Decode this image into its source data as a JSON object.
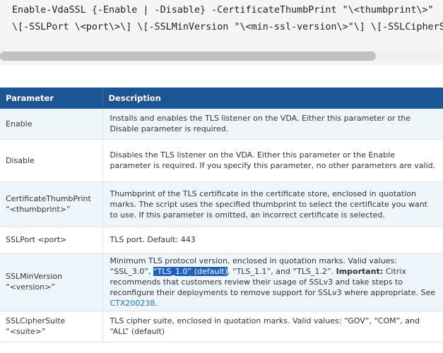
{
  "code": {
    "line1": "Enable-VdaSSL {-Enable | -Disable} -CertificateThumbPrint \"\\<thumbprint\\>\"",
    "line2": "\\[-SSLPort \\<port\\>\\] \\[-SSLMinVersion \"\\<min-ssl-version\\>\"\\] \\[-SSLCipherSuite\""
  },
  "table": {
    "headers": {
      "parameter": "Parameter",
      "description": "Description"
    },
    "rows": [
      {
        "param_line1": "Enable",
        "param_line2": "",
        "desc": "Installs and enables the TLS listener on the VDA. Either this parameter or the Disable parameter is required."
      },
      {
        "param_line1": "Disable",
        "param_line2": "",
        "desc": "Disables the TLS listener on the VDA. Either this parameter or the Enable parameter is required. If you specify this parameter, no other parameters are valid."
      },
      {
        "param_line1": "CertificateThumbPrint",
        "param_line2": "“<thumbprint>”",
        "desc": "Thumbprint of the TLS certificate in the certificate store, enclosed in quotation marks. The script uses the specified thumbprint to select the certificate you want to use. If this parameter is omitted, an incorrect certificate is selected."
      },
      {
        "param_line1": "SSLPort <port>",
        "param_line2": "",
        "desc": "TLS port. Default: 443"
      },
      {
        "param_line1": "SSLMinVersion",
        "param_line2": "“<version>”",
        "desc_parts": {
          "p1": "Minimum TLS protocol version, enclosed in quotation marks. Valid values: “SSL_3.0”, ",
          "highlight": "“TLS_1.0” (default)",
          "p2": ", “TLS_1.1”, and “TLS_1.2”. ",
          "important": "Important:",
          "p3": " Citrix recommends that customers review their usage of SSLv3 and take steps to reconfigure their deployments to remove support for SSLv3 where appropriate. See ",
          "link": "CTX200238",
          "p4": "."
        }
      },
      {
        "param_line1": "SSLCipherSuite",
        "param_line2": "“<suite>”",
        "desc": "TLS cipher suite, enclosed in quotation marks. Valid values: “GOV”, “COM”, and “ALL” (default)"
      }
    ]
  },
  "colors": {
    "header_bg": "#1c5594",
    "highlight_bg": "#1f5fbf",
    "link": "#1a73c9",
    "alt_row_bg": "#eef5fb"
  }
}
